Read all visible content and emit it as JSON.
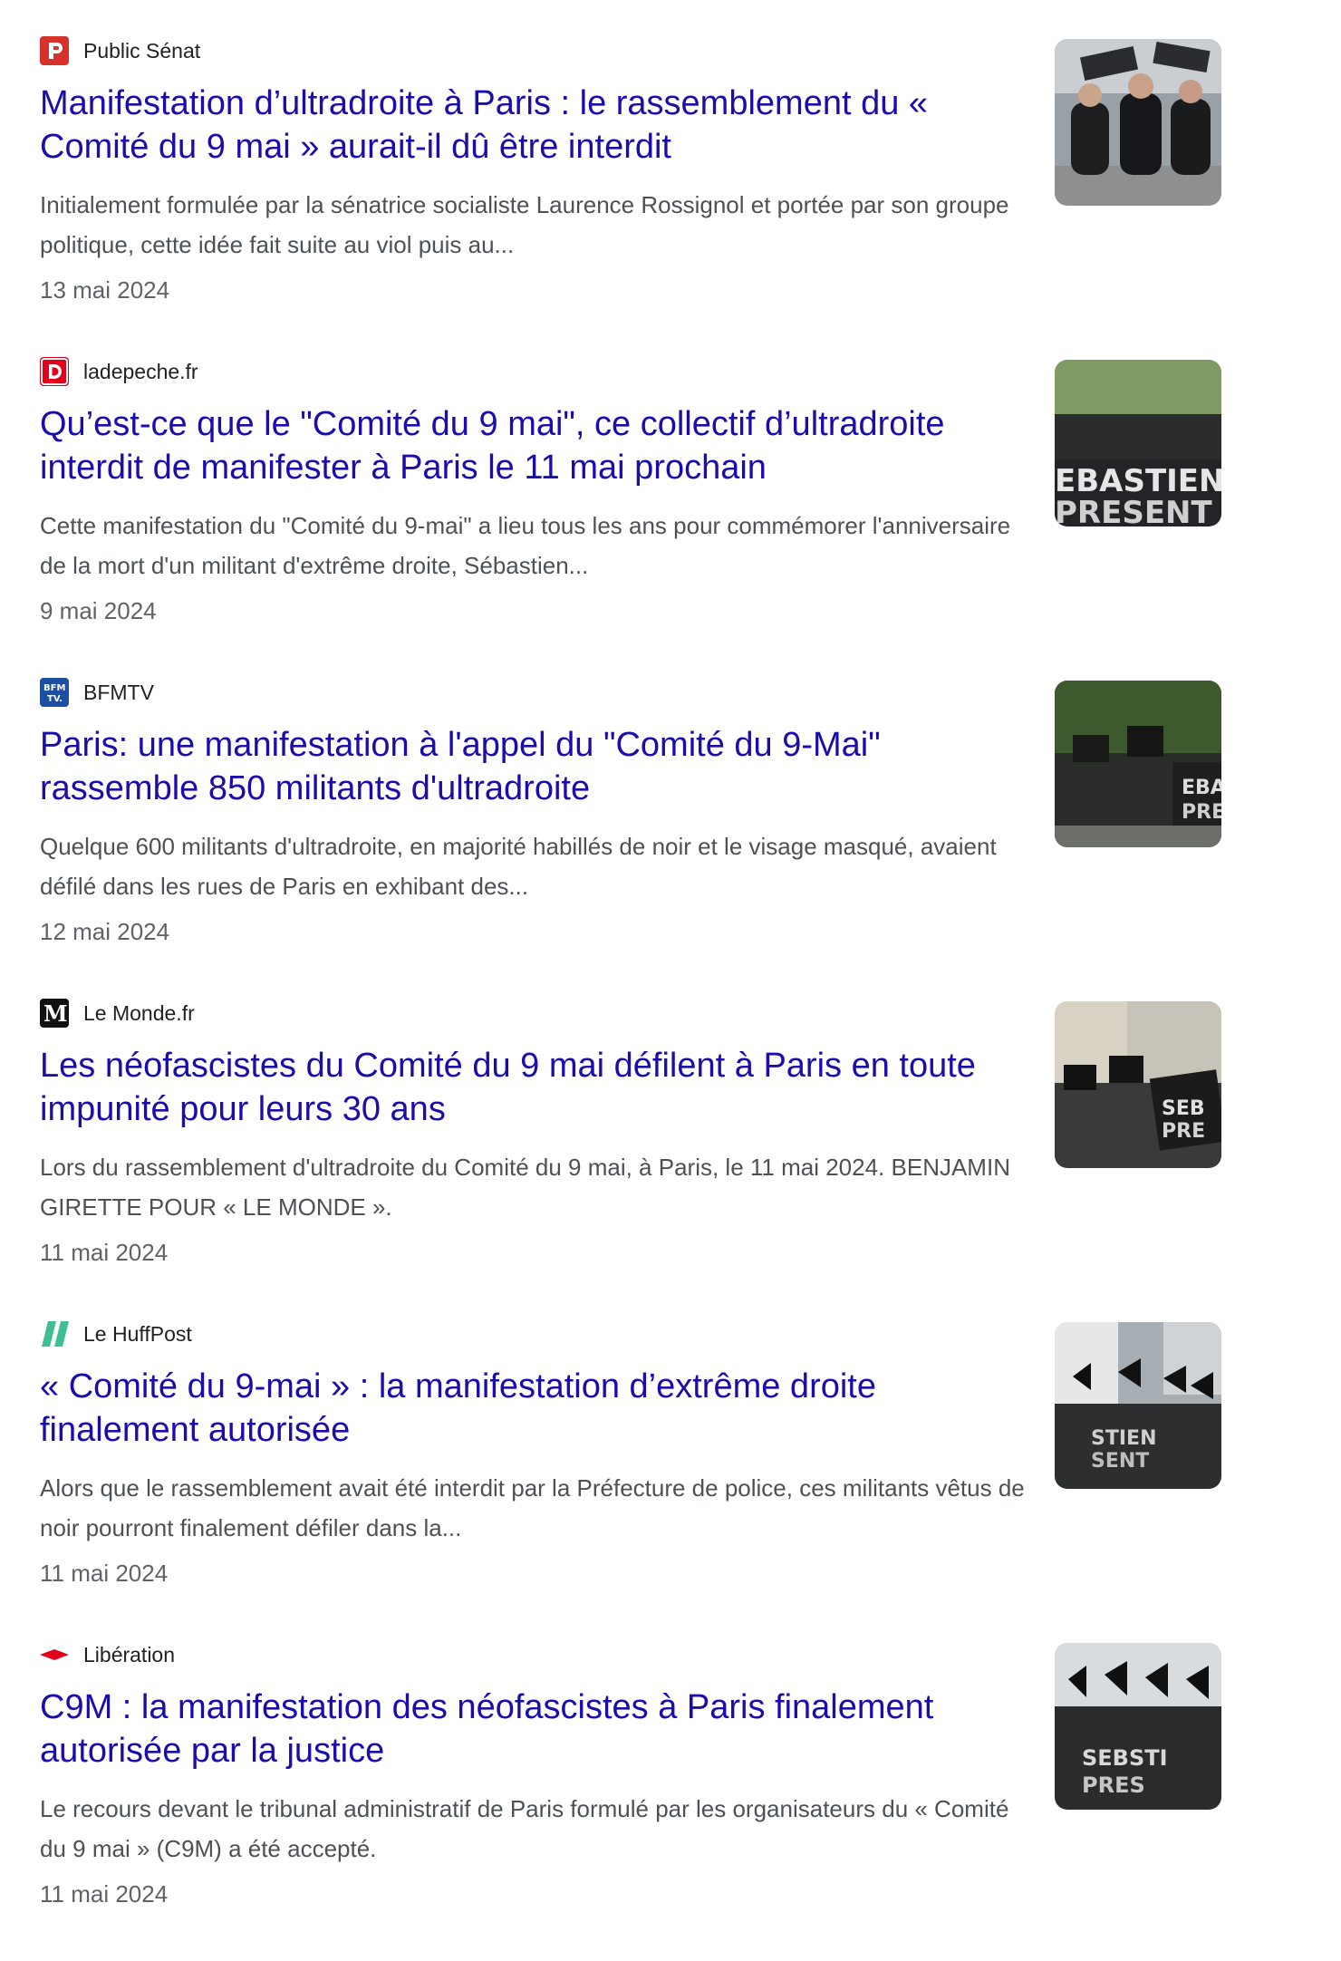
{
  "articles": [
    {
      "source": "Public Sénat",
      "favicon_icon": "public-senat-logo-icon",
      "favicon_color": "#d6322b",
      "title": "Manifestation d’ultradroite à Paris : le rassemblement du « Comité du 9 mai » aurait-il dû être interdit",
      "snippet": "Initialement formulée par la sénatrice socialiste Laurence Rossignol et portée par son groupe politique, cette idée fait suite au viol puis au...",
      "date": "13 mai 2024"
    },
    {
      "source": "ladepeche.fr",
      "favicon_icon": "ladepeche-logo-icon",
      "favicon_color": "#e2001a",
      "title": "Qu’est-ce que le \"Comité du 9 mai\", ce collectif d’ultradroite interdit de manifester à Paris le 11 mai prochain",
      "snippet": "Cette manifestation du \"Comité du 9-mai\" a lieu tous les ans pour commémorer l'anniversaire de la mort d'un militant d'extrême droite, Sébastien...",
      "date": "9 mai 2024"
    },
    {
      "source": "BFMTV",
      "favicon_icon": "bfmtv-logo-icon",
      "favicon_color": "#1c4fa1",
      "title": "Paris: une manifestation à l'appel du \"Comité du 9-Mai\" rassemble 850 militants d'ultradroite",
      "snippet": "Quelque 600 militants d'ultradroite, en majorité habillés de noir et le visage masqué, avaient défilé dans les rues de Paris en exhibant des...",
      "date": "12 mai 2024"
    },
    {
      "source": "Le Monde.fr",
      "favicon_icon": "le-monde-logo-icon",
      "favicon_color": "#111111",
      "title": "Les néofascistes du Comité du 9 mai défilent à Paris en toute impunité pour leurs 30 ans",
      "snippet": "Lors du rassemblement d'ultradroite du Comité du 9 mai, à Paris, le 11 mai 2024. BENJAMIN GIRETTE POUR « LE MONDE ».",
      "date": "11 mai 2024"
    },
    {
      "source": "Le HuffPost",
      "favicon_icon": "huffpost-logo-icon",
      "favicon_color": "#3fbf8f",
      "title": "« Comité du 9-mai » : la manifestation d’extrême droite finalement autorisée",
      "snippet": "Alors que le rassemblement avait été interdit par la Préfecture de police, ces militants vêtus de noir pourront finalement défiler dans la...",
      "date": "11 mai 2024"
    },
    {
      "source": "Libération",
      "favicon_icon": "liberation-logo-icon",
      "favicon_color": "#e3001b",
      "title": "C9M : la manifestation des néofascistes à Paris finalement autorisée par la justice",
      "snippet": "Le recours devant le tribunal administratif de Paris formulé par les organisateurs du « Comité du 9 mai » (C9M) a été accepté.",
      "date": "11 mai 2024"
    }
  ]
}
